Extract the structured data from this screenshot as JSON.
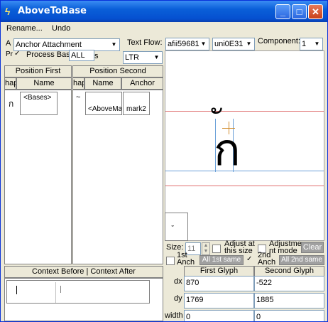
{
  "window": {
    "title": "AboveToBase",
    "app_icon": "lightning-icon"
  },
  "menu": {
    "items": [
      "Rename...",
      "Undo"
    ]
  },
  "toolbar": {
    "lookup_type_prefix": "A",
    "lookup_type": "Anchor Attachment",
    "text_flow_label": "Text Flow:",
    "text_flow": "LTR",
    "glyph1": "afii59681",
    "glyph2": "uni0E31",
    "component_label": "Component:",
    "component": "1",
    "process_prefix": "Pr",
    "process_label": "Process Bas",
    "process_field": "ALL",
    "process_field_tail": "s"
  },
  "columns": {
    "position_first": "Position First",
    "position_second": "Position Second",
    "first_headers": [
      "hap",
      "Name"
    ],
    "second_headers": [
      "hap",
      "Name",
      "Anchor"
    ],
    "first_row": {
      "glyph": "ก",
      "name": "<Bases>"
    },
    "second_row": {
      "glyph": "~",
      "name": "<AboveMa",
      "anchor": "mark2"
    }
  },
  "context": {
    "header": "Context Before | Context After"
  },
  "preview": {
    "thumb_glyph": "ั",
    "main_glyph_base": "ก",
    "main_glyph_mark": "ั"
  },
  "size_row": {
    "size_label": "Size:",
    "size_value": "11",
    "adjust_at_size": "Adjust at this size",
    "adjustment_mode": "Adjustme nt mode",
    "clear": "Clear"
  },
  "anchor_row": {
    "first_anch": "1st Anch",
    "all_first_same": "All 1st same",
    "second_anch": "2nd Anch",
    "all_second_same": "All 2nd same"
  },
  "glyph_table": {
    "headers": [
      "First Glyph",
      "Second Glyph"
    ],
    "rows": [
      {
        "label": "dx",
        "first": "870",
        "second": "-522"
      },
      {
        "label": "dy",
        "first": "1769",
        "second": "1885"
      },
      {
        "label": "width",
        "first": "0",
        "second": "0"
      }
    ]
  }
}
